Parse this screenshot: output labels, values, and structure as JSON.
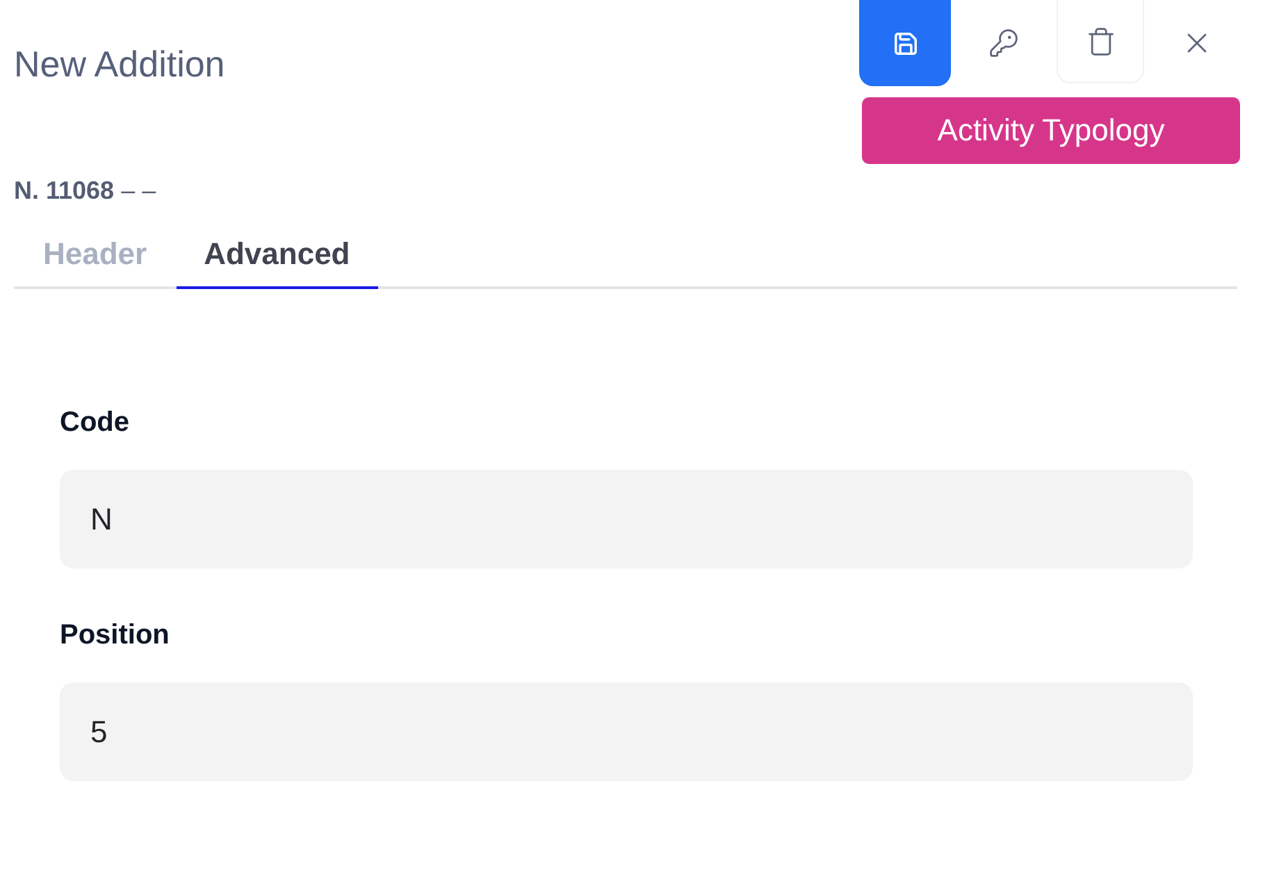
{
  "title": "New Addition",
  "action_button": "Activity Typology",
  "record": "**N. 11068** – –",
  "tabs": [
    {
      "label": "Header",
      "selected": false
    },
    {
      "label": "Advanced",
      "selected": true
    }
  ],
  "fields": [
    {
      "label": "Code",
      "value": "N"
    },
    {
      "label": "Position",
      "value": "5"
    }
  ]
}
